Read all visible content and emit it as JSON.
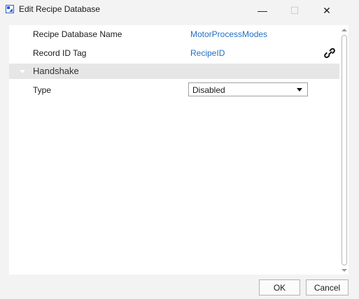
{
  "window": {
    "title": "Edit Recipe Database",
    "minimize_glyph": "—",
    "maximize_glyph": "☐",
    "close_glyph": "✕"
  },
  "properties": {
    "recipe_database_name": {
      "label": "Recipe Database Name",
      "value": "MotorProcessModes"
    },
    "record_id_tag": {
      "label": "Record ID Tag",
      "value": "RecipeID",
      "icon": "link-icon"
    },
    "handshake_section": {
      "label": "Handshake",
      "expanded": true
    },
    "type": {
      "label": "Type",
      "selected": "Disabled"
    }
  },
  "buttons": {
    "ok": "OK",
    "cancel": "Cancel"
  },
  "colors": {
    "value_link": "#1f6fc4",
    "section_bg": "#e6e6e6",
    "window_bg": "#f3f3f3"
  }
}
